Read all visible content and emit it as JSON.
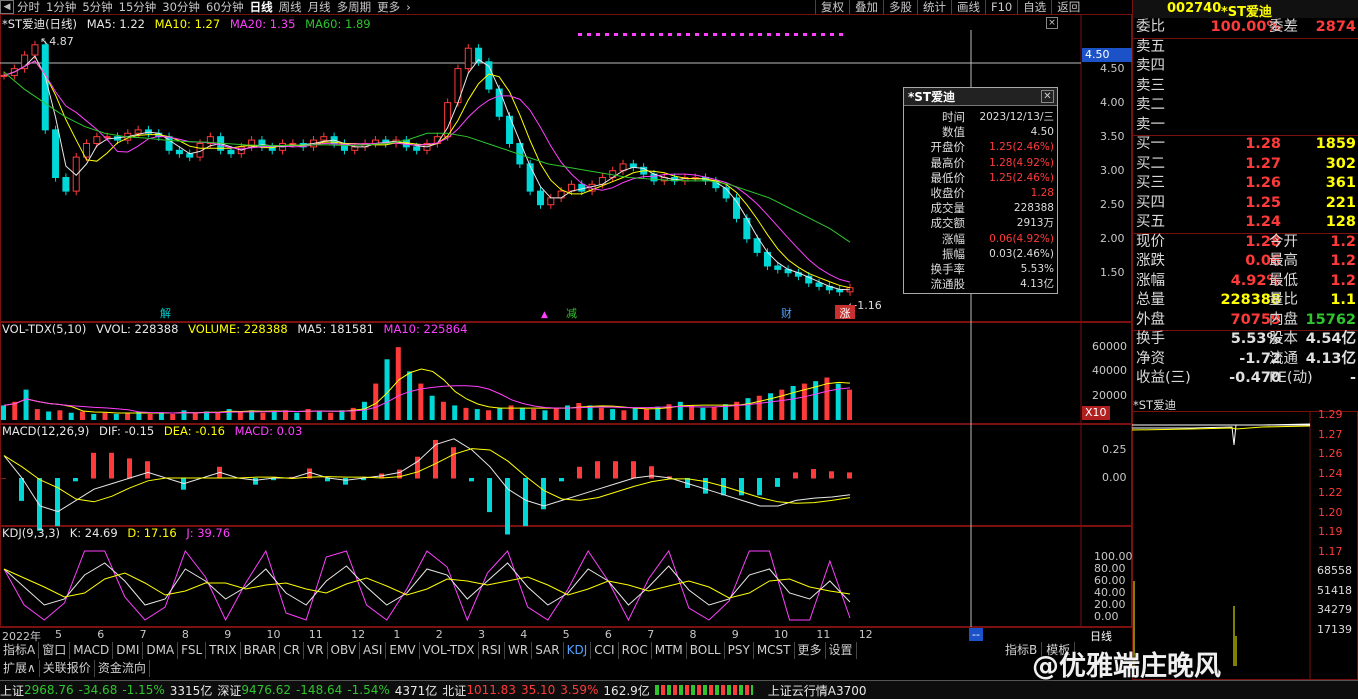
{
  "toolbar": {
    "periods": [
      "分时",
      "1分钟",
      "5分钟",
      "15分钟",
      "30分钟",
      "60分钟",
      "日线",
      "周线",
      "月线",
      "多周期",
      "更多"
    ],
    "active": "日线",
    "tools": [
      "复权",
      "叠加",
      "多股",
      "统计",
      "画线",
      "F10",
      "自选",
      "返回"
    ]
  },
  "header": {
    "code": "002740",
    "name": "*ST爱迪"
  },
  "main_legend": {
    "title": "*ST爱迪(日线)",
    "ma5": "MA5: 1.22",
    "ma10": "MA10: 1.27",
    "ma20": "MA20: 1.35",
    "ma60": "MA60: 1.89"
  },
  "price_axis": {
    "labels": [
      "4.50",
      "4.00",
      "3.50",
      "3.00",
      "2.50",
      "2.00",
      "1.50"
    ],
    "cursor": "4.50",
    "high_mark": "4.87",
    "low_mark": "1.16"
  },
  "event_marks": {
    "jie": "解",
    "jian": "减",
    "cai": "财",
    "zhang": "涨"
  },
  "vol_legend": {
    "title": "VOL-TDX(5,10)",
    "vvol": "VVOL: 228388",
    "volume": "VOLUME: 228388",
    "ma5": "MA5: 181581",
    "ma10": "MA10: 225864"
  },
  "vol_axis": {
    "labels": [
      "60000",
      "40000",
      "20000"
    ],
    "unit": "X10"
  },
  "macd_legend": {
    "title": "MACD(12,26,9)",
    "dif": "DIF: -0.15",
    "dea": "DEA: -0.16",
    "macd": "MACD: 0.03"
  },
  "macd_axis": {
    "labels": [
      "0.25",
      "0.00"
    ]
  },
  "kdj_legend": {
    "title": "KDJ(9,3,3)",
    "k": "K: 24.69",
    "d": "D: 17.16",
    "j": "J: 39.76"
  },
  "kdj_axis": {
    "labels": [
      "100.00",
      "80.00",
      "60.00",
      "40.00",
      "20.00",
      "0.00"
    ]
  },
  "date_axis": {
    "year": "2022年",
    "months": [
      "5",
      "6",
      "7",
      "8",
      "9",
      "10",
      "11",
      "12",
      "1",
      "2",
      "3",
      "4",
      "5",
      "6",
      "7",
      "8",
      "9",
      "10",
      "11",
      "12"
    ],
    "cursor": "--",
    "period_label": "日线"
  },
  "tooltip": {
    "title": "*ST爱迪",
    "rows": [
      {
        "k": "时间",
        "v": "2023/12/13/三",
        "red": false
      },
      {
        "k": "数值",
        "v": "4.50",
        "red": false
      },
      {
        "k": "开盘价",
        "v": "1.25(2.46%)",
        "red": true
      },
      {
        "k": "最高价",
        "v": "1.28(4.92%)",
        "red": true
      },
      {
        "k": "最低价",
        "v": "1.25(2.46%)",
        "red": true
      },
      {
        "k": "收盘价",
        "v": "1.28",
        "red": true
      },
      {
        "k": "成交量",
        "v": "228388",
        "red": false
      },
      {
        "k": "成交额",
        "v": "2913万",
        "red": false
      },
      {
        "k": "涨幅",
        "v": "0.06(4.92%)",
        "red": true
      },
      {
        "k": "振幅",
        "v": "0.03(2.46%)",
        "red": false
      },
      {
        "k": "换手率",
        "v": "5.53%",
        "red": false
      },
      {
        "k": "流通股",
        "v": "4.13亿",
        "red": false
      }
    ]
  },
  "quote": {
    "weibi": {
      "k": "委比",
      "v": "100.00%",
      "k2": "委差",
      "v2": "2874"
    },
    "sell": [
      {
        "k": "卖五",
        "p": "",
        "q": ""
      },
      {
        "k": "卖四",
        "p": "",
        "q": ""
      },
      {
        "k": "卖三",
        "p": "",
        "q": ""
      },
      {
        "k": "卖二",
        "p": "",
        "q": ""
      },
      {
        "k": "卖一",
        "p": "",
        "q": ""
      }
    ],
    "buy": [
      {
        "k": "买一",
        "p": "1.28",
        "q": "1859"
      },
      {
        "k": "买二",
        "p": "1.27",
        "q": "302"
      },
      {
        "k": "买三",
        "p": "1.26",
        "q": "361"
      },
      {
        "k": "买四",
        "p": "1.25",
        "q": "221"
      },
      {
        "k": "买五",
        "p": "1.24",
        "q": "128"
      }
    ],
    "stats": [
      {
        "k": "现价",
        "v": "1.28",
        "c": "#ff3a3a",
        "k2": "今开",
        "v2": "1.2",
        "c2": "#ff3a3a"
      },
      {
        "k": "涨跌",
        "v": "0.06",
        "c": "#ff3a3a",
        "k2": "最高",
        "v2": "1.2",
        "c2": "#ff3a3a"
      },
      {
        "k": "涨幅",
        "v": "4.92%",
        "c": "#ff3a3a",
        "k2": "最低",
        "v2": "1.2",
        "c2": "#ff3a3a"
      },
      {
        "k": "总量",
        "v": "228388",
        "c": "#ffff00",
        "k2": "量比",
        "v2": "1.1",
        "c2": "#ffff00"
      },
      {
        "k": "外盘",
        "v": "70759",
        "c": "#ff3a3a",
        "k2": "内盘",
        "v2": "15762",
        "c2": "#2ec52e"
      }
    ],
    "stats2": [
      {
        "k": "换手",
        "v": "5.53%",
        "c": "#e0e0e0",
        "k2": "股本",
        "v2": "4.54亿",
        "c2": "#e0e0e0"
      },
      {
        "k": "净资",
        "v": "-1.72",
        "c": "#e0e0e0",
        "k2": "流通",
        "v2": "4.13亿",
        "c2": "#e0e0e0"
      },
      {
        "k": "收益(三)",
        "v": "-0.470",
        "c": "#e0e0e0",
        "k2": "PE(动)",
        "v2": "-",
        "c2": "#e0e0e0"
      }
    ]
  },
  "mini_chart": {
    "title": "*ST爱迪",
    "price_labels": [
      "1.29",
      "1.27",
      "1.26",
      "1.24",
      "1.22",
      "1.20",
      "1.19",
      "1.17"
    ],
    "vol_labels": [
      "68558",
      "51418",
      "34279",
      "17139"
    ]
  },
  "tabs": [
    "指标A",
    "窗口",
    "MACD",
    "DMI",
    "DMA",
    "FSL",
    "TRIX",
    "BRAR",
    "CR",
    "VR",
    "OBV",
    "ASI",
    "EMV",
    "VOL-TDX",
    "RSI",
    "WR",
    "SAR",
    "KDJ",
    "CCI",
    "ROC",
    "MTM",
    "BOLL",
    "PSY",
    "MCST",
    "更多",
    "设置"
  ],
  "tabs_active": "KDJ",
  "tabs_right": [
    "指标B",
    "模板"
  ],
  "tabs2": [
    "扩展∧",
    "关联报价",
    "资金流向"
  ],
  "status": {
    "sh_name": "上证",
    "sh_val": "2968.76",
    "sh_chg": "-34.68",
    "sh_pct": "-1.15%",
    "sh_amt": "3315亿",
    "sz_name": "深证",
    "sz_val": "9476.62",
    "sz_chg": "-148.64",
    "sz_pct": "-1.54%",
    "sz_amt": "4371亿",
    "bz_name": "北证",
    "bz_val": "1011.83",
    "bz_chg": "35.10",
    "bz_pct": "3.59%",
    "bz_amt": "162.9亿",
    "news": "上证云行情A3700"
  },
  "watermark": "@优雅端庄晚风",
  "chart_data": {
    "type": "candlestick",
    "title": "*ST爱迪(日线)",
    "ylim": [
      1.1,
      4.95
    ],
    "close": [
      4.4,
      4.5,
      4.7,
      4.85,
      3.6,
      2.9,
      2.7,
      3.2,
      3.4,
      3.5,
      3.5,
      3.45,
      3.55,
      3.6,
      3.55,
      3.5,
      3.3,
      3.25,
      3.2,
      3.4,
      3.5,
      3.3,
      3.25,
      3.35,
      3.45,
      3.35,
      3.3,
      3.4,
      3.4,
      3.35,
      3.45,
      3.5,
      3.4,
      3.3,
      3.35,
      3.4,
      3.45,
      3.4,
      3.45,
      3.35,
      3.3,
      3.4,
      3.5,
      4.0,
      4.5,
      4.8,
      4.6,
      4.2,
      3.8,
      3.4,
      3.1,
      2.7,
      2.5,
      2.6,
      2.7,
      2.8,
      2.7,
      2.8,
      2.9,
      3.0,
      3.1,
      3.05,
      2.95,
      2.85,
      2.9,
      2.85,
      2.9,
      2.9,
      2.85,
      2.75,
      2.6,
      2.3,
      2.0,
      1.8,
      1.6,
      1.55,
      1.5,
      1.45,
      1.35,
      1.3,
      1.25,
      1.22,
      1.28
    ],
    "ma60": [
      4.45,
      4.2,
      4.0,
      3.8,
      3.65,
      3.55,
      3.5,
      3.48,
      3.45,
      3.43,
      3.42,
      3.4,
      3.38,
      3.37,
      3.37,
      3.38,
      3.38,
      3.37,
      3.38,
      3.4,
      3.45,
      3.55,
      3.55,
      3.5,
      3.4,
      3.3,
      3.2,
      3.1,
      3.05,
      3.0,
      2.95,
      2.9,
      2.88,
      2.86,
      2.85,
      2.85,
      2.8,
      2.7,
      2.6,
      2.45,
      2.3,
      2.15,
      1.95
    ],
    "volume": [
      12000,
      15000,
      25000,
      9000,
      7000,
      8000,
      6000,
      7000,
      5000,
      6000,
      5000,
      6000,
      7000,
      5000,
      6000,
      5000,
      8000,
      6000,
      7000,
      6000,
      9000,
      7000,
      8000,
      6000,
      7000,
      8000,
      6000,
      9000,
      7000,
      6000,
      8000,
      10000,
      15000,
      30000,
      50000,
      60000,
      40000,
      30000,
      20000,
      15000,
      12000,
      10000,
      9000,
      8000,
      10000,
      12000,
      10000,
      9000,
      8000,
      10000,
      12000,
      14000,
      12000,
      10000,
      9000,
      8000,
      10000,
      9000,
      11000,
      13000,
      15000,
      12000,
      10000,
      11000,
      13000,
      15000,
      18000,
      20000,
      22000,
      25000,
      28000,
      30000,
      32000,
      35000,
      30000,
      25000
    ],
    "macd_dif": [
      0.2,
      0.0,
      -0.25,
      -0.3,
      -0.2,
      -0.1,
      -0.05,
      0.0,
      0.05,
      0.0,
      -0.05,
      0.0,
      0.05,
      0.0,
      -0.02,
      0.0,
      0.0,
      0.05,
      0.0,
      -0.02,
      0.0,
      0.02,
      0.05,
      0.15,
      0.3,
      0.35,
      0.25,
      0.1,
      -0.1,
      -0.2,
      -0.25,
      -0.2,
      -0.15,
      -0.1,
      -0.05,
      0.0,
      0.02,
      0.0,
      -0.05,
      -0.1,
      -0.15,
      -0.2,
      -0.25,
      -0.25,
      -0.2,
      -0.18,
      -0.17,
      -0.15
    ],
    "kdj_k": [
      80,
      50,
      20,
      30,
      70,
      90,
      60,
      20,
      30,
      80,
      60,
      30,
      50,
      80,
      40,
      20,
      60,
      85,
      50,
      20,
      40,
      80,
      70,
      30,
      60,
      90,
      50,
      20,
      40,
      80,
      60,
      20,
      50,
      85,
      45,
      20,
      30,
      70,
      80,
      40,
      30,
      60,
      25
    ]
  }
}
